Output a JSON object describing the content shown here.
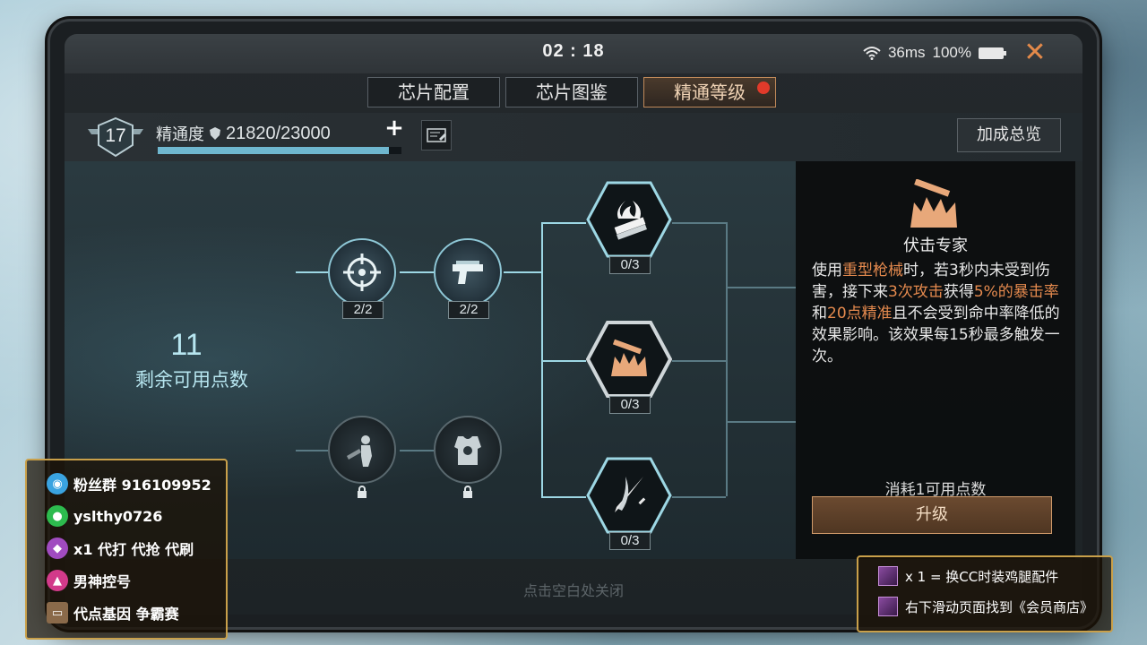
{
  "status": {
    "time": "02 : 18",
    "ping": "36ms",
    "battery": "100%"
  },
  "tabs": [
    {
      "label": "芯片配置",
      "active": false
    },
    {
      "label": "芯片图鉴",
      "active": false
    },
    {
      "label": "精通等级",
      "active": true
    }
  ],
  "mastery": {
    "level": "17",
    "label": "精通度",
    "value": "21820/23000",
    "progress": 0.9487,
    "bonus_button": "加成总览"
  },
  "points": {
    "remaining": "11",
    "label": "剩余可用点数"
  },
  "tree": {
    "nodes": [
      {
        "icon": "crosshair-icon",
        "count": "2/2",
        "locked": false
      },
      {
        "icon": "pistol-icon",
        "count": "2/2",
        "locked": false
      },
      {
        "icon": "fire-ammo-icon",
        "count": "0/3",
        "locked": false
      },
      {
        "icon": "ambush-icon",
        "count": "0/3",
        "locked": false
      },
      {
        "icon": "blades-icon",
        "count": "0/3",
        "locked": false
      },
      {
        "icon": "target-dummy-icon",
        "count": "",
        "locked": true
      },
      {
        "icon": "armor-vest-icon",
        "count": "",
        "locked": true
      }
    ]
  },
  "detail": {
    "title": "伏击专家",
    "desc_parts": [
      {
        "t": "使用",
        "h": false
      },
      {
        "t": "重型枪械",
        "h": true
      },
      {
        "t": "时，若3秒内未受到伤害，接下来",
        "h": false
      },
      {
        "t": "3次攻击",
        "h": true
      },
      {
        "t": "获得",
        "h": false
      },
      {
        "t": "5%的暴击率",
        "h": true
      },
      {
        "t": "和",
        "h": false
      },
      {
        "t": "20点精准",
        "h": true
      },
      {
        "t": "且不会受到命中率降低的效果影响。该效果每15秒最多触发一次。",
        "h": false
      }
    ],
    "cost": "消耗1可用点数",
    "upgrade_button": "升级"
  },
  "hint": "点击空白处关闭",
  "overlay_left": [
    {
      "icon": "qq-icon",
      "text": "粉丝群 916109952",
      "color": "#3aa3e0"
    },
    {
      "icon": "wechat-icon",
      "text": "yslthy0726",
      "color": "#2dbb4e"
    },
    {
      "icon": "gem-icon",
      "text": "x1 代打 代抢 代刷",
      "color": "#a04bc0"
    },
    {
      "icon": "rocket-icon",
      "text": "男神控号",
      "color": "#d23a8a"
    },
    {
      "icon": "card-icon",
      "text": "代点基因 争霸赛",
      "color": "#8a6a4a"
    }
  ],
  "overlay_right": [
    {
      "text": "x 1 = 换CC时装鸡腿配件"
    },
    {
      "text": "右下滑动页面找到《会员商店》"
    }
  ],
  "colors": {
    "accent": "#e58a4e",
    "line": "#9dd7e4",
    "tab_active_border": "#c08a5a"
  }
}
